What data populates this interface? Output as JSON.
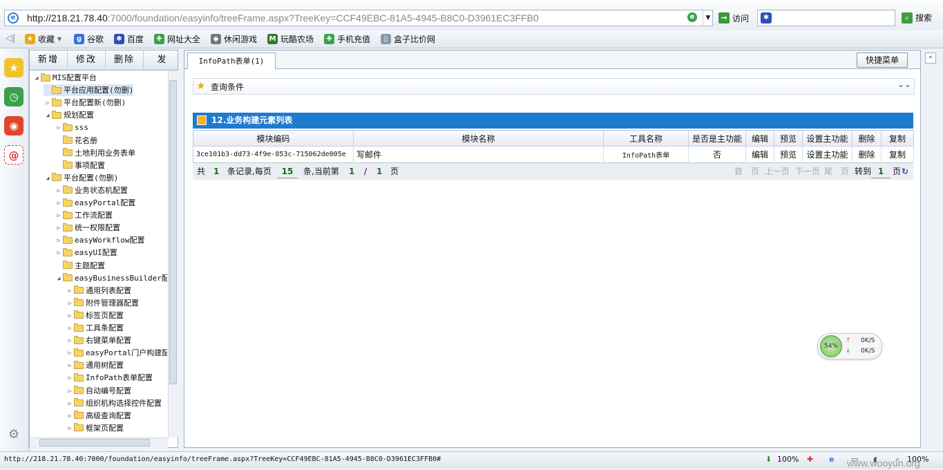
{
  "browser": {
    "url_host": "http://218.21.78.40",
    "url_rest": ":7000/foundation/easyinfo/treeFrame.aspx?TreeKey=CCF49EBC-81A5-4945-B8C0-D3961EC3FFB0",
    "go_label": "访问",
    "search_label": "搜索"
  },
  "favorites": [
    {
      "label": "收藏",
      "icon": "star-icon",
      "color": "#e8a814"
    },
    {
      "label": "谷歌",
      "icon": "google-icon",
      "color": "#3a6fd8"
    },
    {
      "label": "百度",
      "icon": "baidu-icon",
      "color": "#2d4fb6"
    },
    {
      "label": "网址大全",
      "icon": "sites-icon",
      "color": "#3aa14a"
    },
    {
      "label": "休闲游戏",
      "icon": "gamepad-icon",
      "color": "#777777"
    },
    {
      "label": "玩酷农场",
      "icon": "farm-icon",
      "color": "#2f7a2f"
    },
    {
      "label": "手机充值",
      "icon": "phone-icon",
      "color": "#3aa14a"
    },
    {
      "label": "盒子比价网",
      "icon": "page-icon",
      "color": "#8899aa"
    }
  ],
  "tree_toolbar": {
    "add": "新增",
    "edit": "修改",
    "delete": "删除",
    "more": "发"
  },
  "tree": [
    {
      "label": "MIS配置平台",
      "expand": "◢"
    },
    {
      "label": "平台应用配置(勿删)",
      "expand": ""
    },
    {
      "label": "平台配置新(勿删)",
      "expand": "▷"
    },
    {
      "label": "规划配置",
      "expand": "◢"
    },
    {
      "label": "sss",
      "expand": "▷"
    },
    {
      "label": "花名册",
      "expand": ""
    },
    {
      "label": "土地利用业务表单",
      "expand": ""
    },
    {
      "label": "事项配置",
      "expand": ""
    },
    {
      "label": "平台配置(勿删)",
      "expand": "◢"
    },
    {
      "label": "业务状态机配置",
      "expand": "▷"
    },
    {
      "label": "easyPortal配置",
      "expand": "▷"
    },
    {
      "label": "工作流配置",
      "expand": "▷"
    },
    {
      "label": "统一权限配置",
      "expand": "▷"
    },
    {
      "label": "easyWorkflow配置",
      "expand": "▷"
    },
    {
      "label": "easyUI配置",
      "expand": "▷"
    },
    {
      "label": "主题配置",
      "expand": ""
    },
    {
      "label": "easyBusinessBuilder配置",
      "expand": "◢"
    },
    {
      "label": "通用列表配置",
      "expand": "▷"
    },
    {
      "label": "附件管理器配置",
      "expand": "▷"
    },
    {
      "label": "标签页配置",
      "expand": "▷"
    },
    {
      "label": "工具条配置",
      "expand": "▷"
    },
    {
      "label": "右键菜单配置",
      "expand": "▷"
    },
    {
      "label": "easyPortal门户构建配置",
      "expand": "▷"
    },
    {
      "label": "通用树配置",
      "expand": "▷"
    },
    {
      "label": "InfoPath表单配置",
      "expand": "▷"
    },
    {
      "label": "自动编号配置",
      "expand": "▷"
    },
    {
      "label": "组织机构选择控件配置",
      "expand": "▷"
    },
    {
      "label": "高级查询配置",
      "expand": "▷"
    },
    {
      "label": "框架页配置",
      "expand": "▷"
    }
  ],
  "main": {
    "tab_label": "InfoPath表单(1)",
    "quick_menu": "快捷菜单",
    "query_label": "查询条件",
    "grid_title": "12.业务构建元素列表",
    "columns": [
      "模块编码",
      "模块名称",
      "工具名称",
      "是否是主功能",
      "编辑",
      "预览",
      "设置主功能",
      "删除",
      "复制"
    ],
    "rows": [
      [
        "3ce101b3-dd73-4f9e-853c-715062de005e",
        "写邮件",
        "InfoPath表单",
        "否",
        "编辑",
        "预览",
        "设置主功能",
        "删除",
        "复制"
      ]
    ],
    "pager": {
      "total_prefix": "共",
      "total": "1",
      "total_suffix": "条记录,每页",
      "page_size": "15",
      "size_suffix": "条,当前第",
      "current": "1",
      "slash": "/",
      "pages": "1",
      "page_word": "页",
      "first": "首",
      "page1": "页",
      "prev": "上一页",
      "next": "下一页",
      "last": "尾",
      "page2": "页",
      "goto_label": "转到",
      "goto_value": "1",
      "goto_suffix": "页"
    }
  },
  "net_widget": {
    "percent": "54%",
    "up": "0K/S",
    "down": "0K/S"
  },
  "status": {
    "url": "http://218.21.78.40:7000/foundation/easyinfo/treeFrame.aspx?TreeKey=CCF49EBC-81A5-4945-B8C0-D3961EC3FFB0#",
    "zoom_left": "100%",
    "zoom_right": "100%",
    "watermark": "www.wooyun.org"
  }
}
